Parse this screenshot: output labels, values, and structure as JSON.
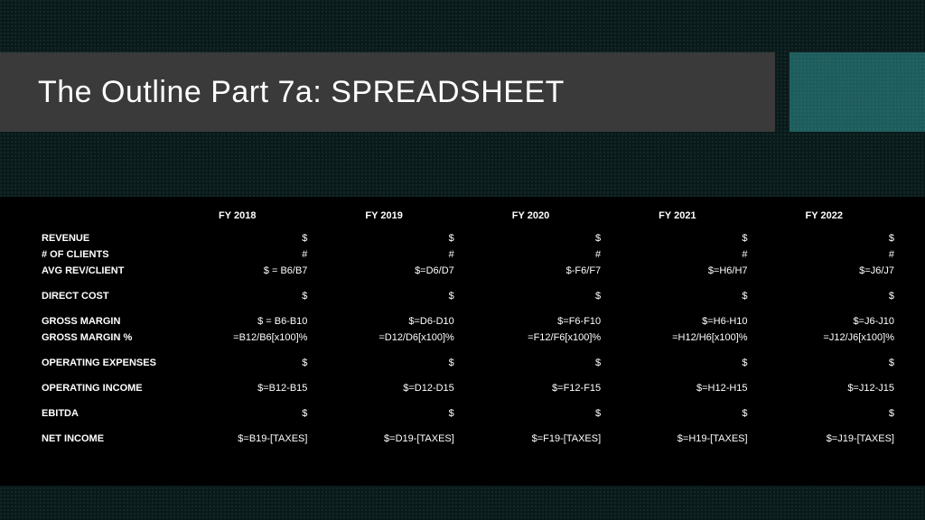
{
  "title": "The Outline Part 7a: SPREADSHEET",
  "years": [
    "FY 2018",
    "FY 2019",
    "FY 2020",
    "FY 2021",
    "FY 2022"
  ],
  "rows": [
    {
      "label": "REVENUE",
      "cells": [
        "$",
        "$",
        "$",
        "$",
        "$"
      ]
    },
    {
      "label": "# OF CLIENTS",
      "cells": [
        "#",
        "#",
        "#",
        "#",
        "#"
      ]
    },
    {
      "label": "AVG REV/CLIENT",
      "cells": [
        "$ = B6/B7",
        "$=D6/D7",
        "$-F6/F7",
        "$=H6/H7",
        "$=J6/J7"
      ]
    },
    {
      "gap": true
    },
    {
      "label": "DIRECT COST",
      "cells": [
        "$",
        "$",
        "$",
        "$",
        "$"
      ]
    },
    {
      "gap": true
    },
    {
      "label": "GROSS MARGIN",
      "cells": [
        "$ = B6-B10",
        "$=D6-D10",
        "$=F6-F10",
        "$=H6-H10",
        "$=J6-J10"
      ]
    },
    {
      "label": "GROSS MARGIN %",
      "cells": [
        "=B12/B6[x100]%",
        "=D12/D6[x100]%",
        "=F12/F6[x100]%",
        "=H12/H6[x100]%",
        "=J12/J6[x100]%"
      ]
    },
    {
      "gap": true
    },
    {
      "label": "OPERATING EXPENSES",
      "cells": [
        "$",
        "$",
        "$",
        "$",
        "$"
      ]
    },
    {
      "gap": true
    },
    {
      "label": "OPERATING INCOME",
      "cells": [
        "$=B12-B15",
        "$=D12-D15",
        "$=F12-F15",
        "$=H12-H15",
        "$=J12-J15"
      ]
    },
    {
      "gap": true
    },
    {
      "label": "EBITDA",
      "cells": [
        "$",
        "$",
        "$",
        "$",
        "$"
      ]
    },
    {
      "gap": true
    },
    {
      "label": "NET INCOME",
      "cells": [
        "$=B19-[TAXES]",
        "$=D19-[TAXES]",
        "$=F19-[TAXES]",
        "$=H19-[TAXES]",
        "$=J19-[TAXES]"
      ]
    }
  ]
}
